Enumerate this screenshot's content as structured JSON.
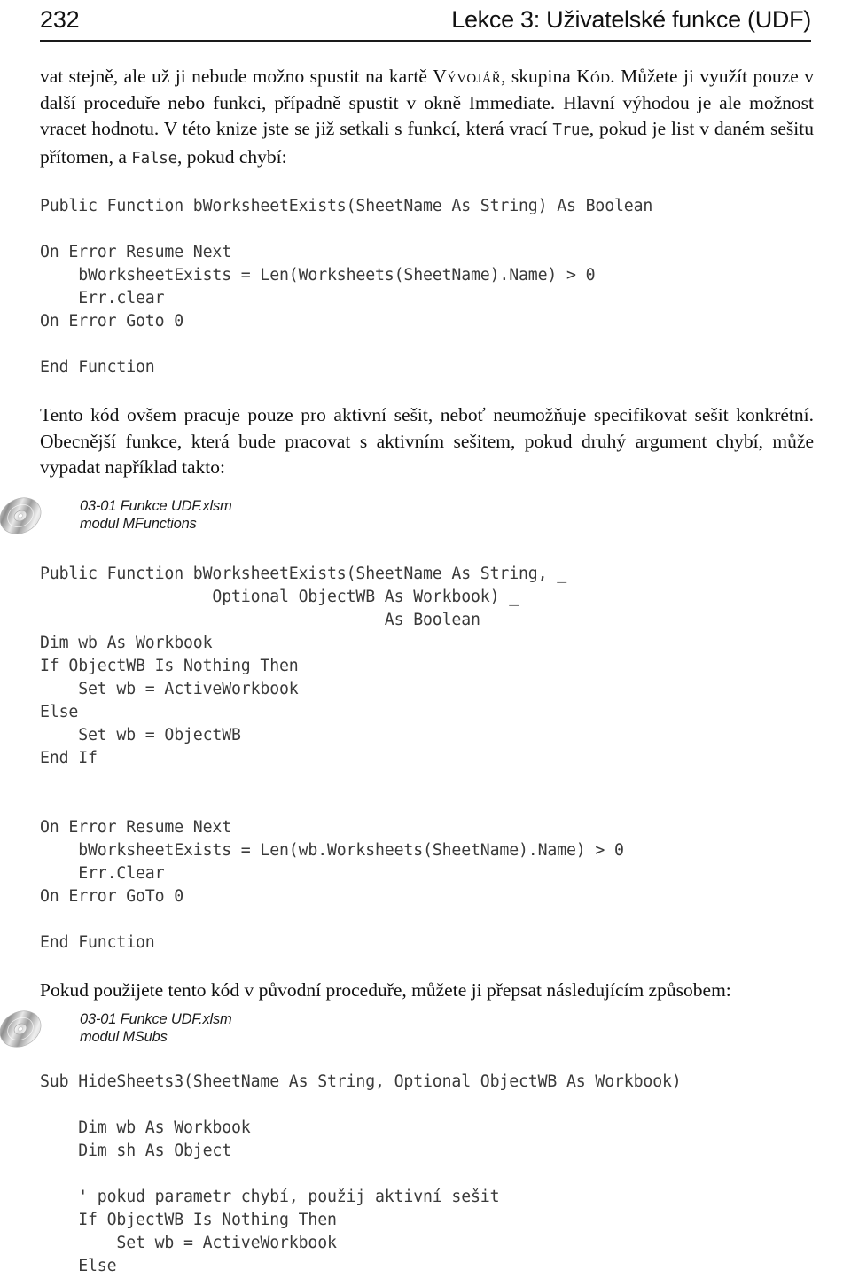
{
  "header": {
    "folio": "232",
    "running_title": "Lekce 3: Uživatelské funkce (UDF)"
  },
  "paragraphs": {
    "intro_1": "vat stejně, ale už ji nebude možno spustit na kartě ",
    "intro_smallcaps_1": "Vývojář",
    "intro_2": ", skupina ",
    "intro_smallcaps_2": "Kód",
    "intro_3": ". Můžete ji využít pouze v další proceduře nebo funkci, případně spustit v okně Immediate. Hlavní výhodou je ale možnost vracet hodnotu. V této knize jste se již setkali s funkcí, která vrací ",
    "intro_code_1": "True",
    "intro_4": ", pokud je list v daném sešitu přítomen, a ",
    "intro_code_2": "False",
    "intro_5": ", pokud chybí:",
    "after_code_1": "Tento kód ovšem pracuje pouze pro aktivní sešit, neboť neumožňuje specifikovat sešit konkrétní. Obecnější funkce, která bude pracovat s aktivním sešitem, pokud druhý argument chybí, může vypadat například takto:",
    "after_code_2": "Pokud použijete tento kód v původní proceduře, můžete ji přepsat následujícím způsobem:"
  },
  "media_notes": {
    "note_1": {
      "file": "03-01 Funkce UDF.xlsm",
      "module": "modul MFunctions",
      "icon": "cd-disc-icon"
    },
    "note_2": {
      "file": "03-01 Funkce UDF.xlsm",
      "module": "modul MSubs",
      "icon": "cd-disc-icon"
    }
  },
  "code_blocks": {
    "block_1": "Public Function bWorksheetExists(SheetName As String) As Boolean\n\nOn Error Resume Next\n    bWorksheetExists = Len(Worksheets(SheetName).Name) > 0\n    Err.clear\nOn Error Goto 0\n\nEnd Function",
    "block_2a": "Public Function bWorksheetExists(SheetName As String, _\n                  Optional ObjectWB As Workbook) _\n                                    As Boolean\nDim wb As Workbook\nIf ObjectWB Is Nothing Then\n    Set wb = ActiveWorkbook\nElse\n    Set wb = ObjectWB\nEnd If",
    "block_2b": "On Error Resume Next\n    bWorksheetExists = Len(wb.Worksheets(SheetName).Name) > 0\n    Err.Clear\nOn Error GoTo 0\n\nEnd Function",
    "block_3": "Sub HideSheets3(SheetName As String, Optional ObjectWB As Workbook)\n\n    Dim wb As Workbook\n    Dim sh As Object\n\n    ' pokud parametr chybí, použij aktivní sešit\n    If ObjectWB Is Nothing Then\n        Set wb = ActiveWorkbook\n    Else"
  },
  "colors": {
    "text": "#101010",
    "code_text": "#3a3a3a",
    "rule": "#1a1a1a",
    "background": "#ffffff"
  }
}
